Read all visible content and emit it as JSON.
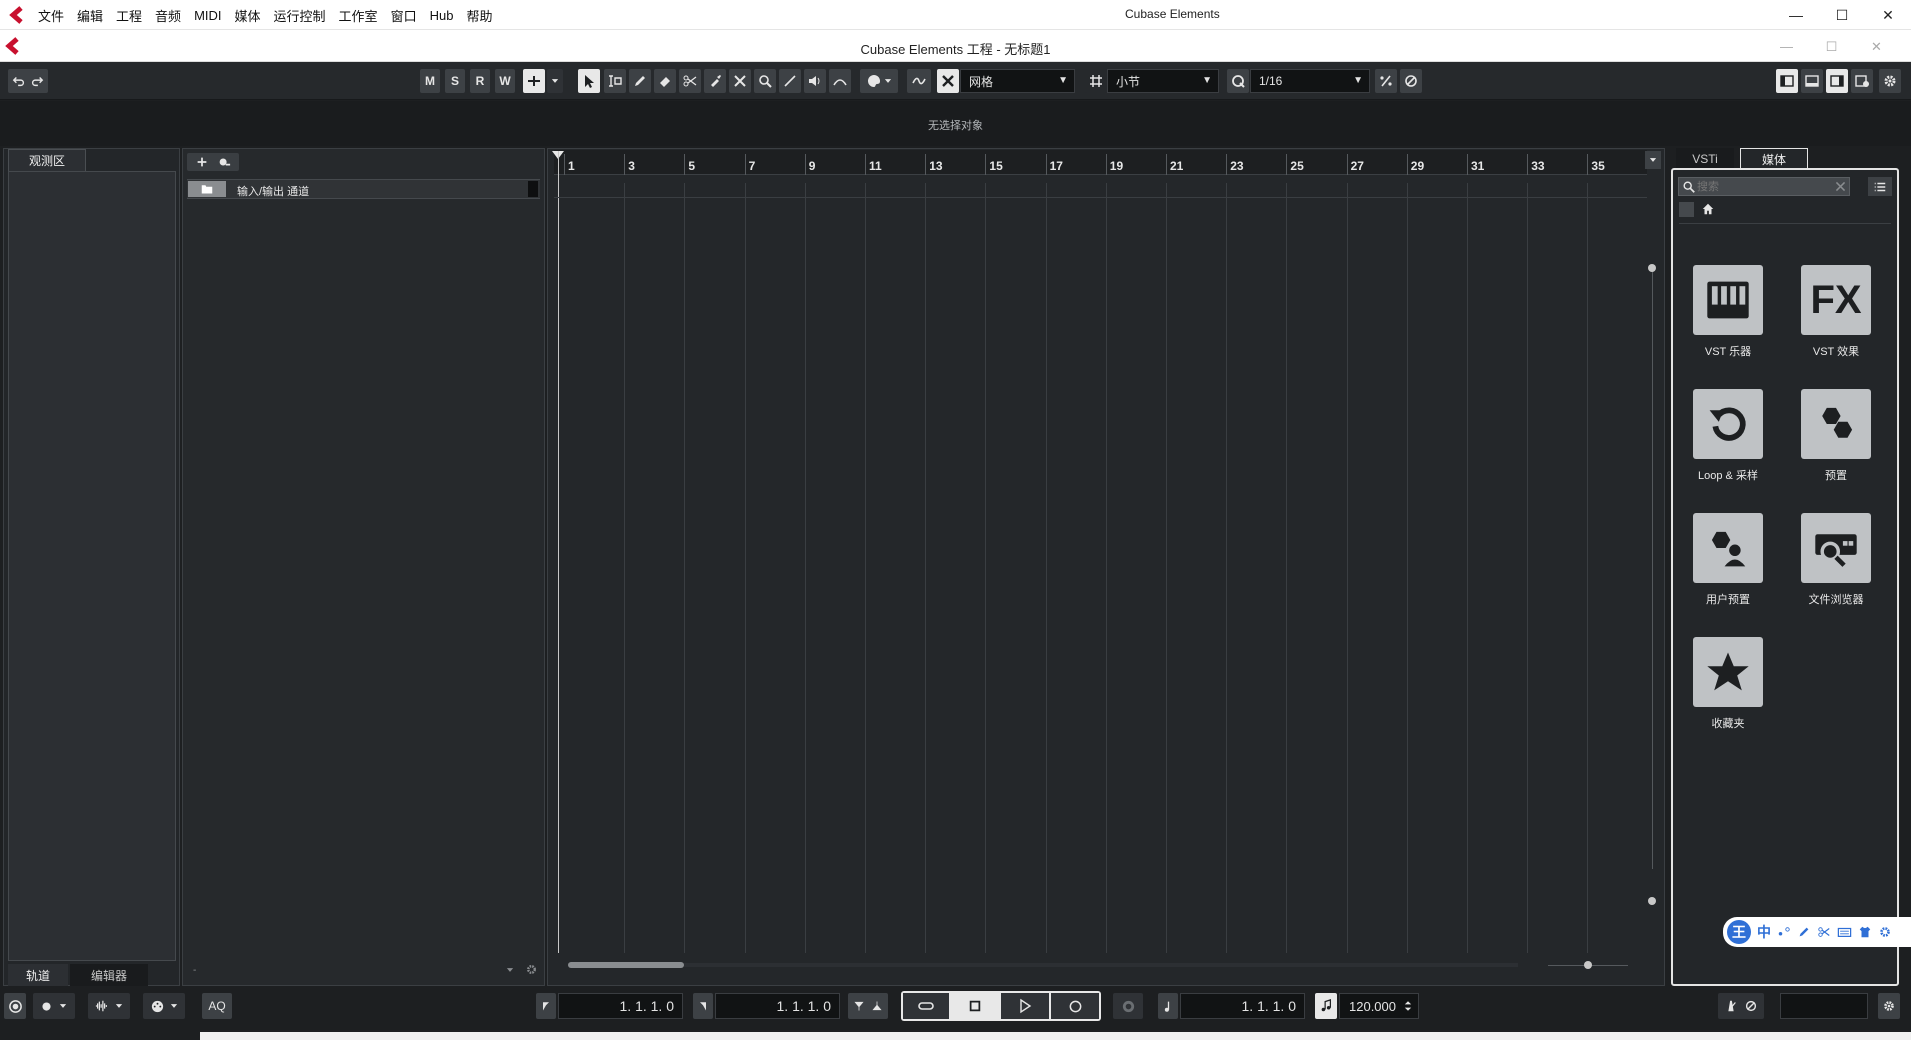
{
  "os_menubar": {
    "items": [
      "文件",
      "编辑",
      "工程",
      "音频",
      "MIDI",
      "媒体",
      "运行控制",
      "工作室",
      "窗口",
      "Hub",
      "帮助"
    ],
    "app_title": "Cubase Elements",
    "minimize": "—",
    "maximize": "☐",
    "close": "✕"
  },
  "project_window": {
    "title": "Cubase Elements 工程 - 无标题1",
    "minimize": "—",
    "maximize": "☐",
    "close": "✕"
  },
  "toolbar": {
    "mute": "M",
    "solo": "S",
    "read": "R",
    "write": "W",
    "snap_type": "网格",
    "grid_type": "小节",
    "quantize": "1/16"
  },
  "info_line": "无选择对象",
  "inspector": {
    "tab_title": "观测区",
    "bottom_tabs": [
      "轨道",
      "编辑器"
    ]
  },
  "tracklist": {
    "tracks": [
      {
        "name": "输入/输出 通道"
      }
    ]
  },
  "ruler": {
    "bars": [
      "1",
      "3",
      "5",
      "7",
      "9",
      "11",
      "13",
      "15",
      "17",
      "19",
      "21",
      "23",
      "25",
      "27",
      "29",
      "31",
      "33",
      "35"
    ]
  },
  "right_zone": {
    "tabs": [
      "VSTi",
      "媒体"
    ],
    "search_placeholder": "搜索",
    "tiles": [
      {
        "label": "VST 乐器",
        "icon": "piano-keys-icon"
      },
      {
        "label": "VST 效果",
        "icon": "fx-icon"
      },
      {
        "label": "Loop & 采样",
        "icon": "loop-icon"
      },
      {
        "label": "预置",
        "icon": "hexagons-icon"
      },
      {
        "label": "用户预置",
        "icon": "user-preset-icon"
      },
      {
        "label": "文件浏览器",
        "icon": "file-browser-icon"
      },
      {
        "label": "收藏夹",
        "icon": "star-icon"
      }
    ]
  },
  "transport": {
    "aq": "AQ",
    "left_locator": "1. 1. 1.   0",
    "right_locator": "1. 1. 1.   0",
    "position": "1. 1. 1.   0",
    "tempo": "120.000"
  },
  "ime": {
    "logo": "王",
    "mode": "中"
  }
}
